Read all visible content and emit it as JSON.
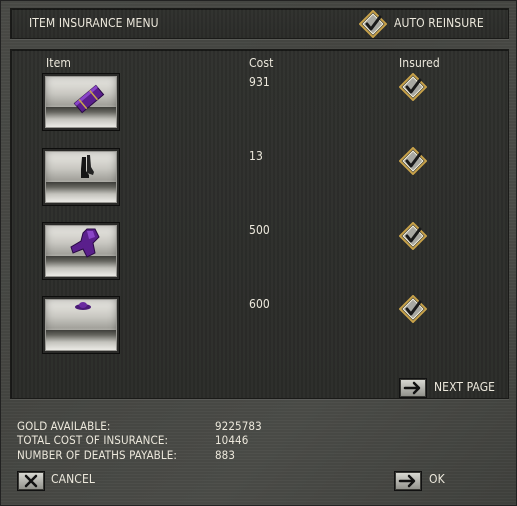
{
  "header": {
    "title": "ITEM INSURANCE MENU",
    "auto_reinsure_label": "AUTO REINSURE",
    "auto_reinsure_checked": true
  },
  "columns": {
    "item": "Item",
    "cost": "Cost",
    "insured": "Insured"
  },
  "items": [
    {
      "cost": "931",
      "insured": true,
      "icon": "purple-book-icon"
    },
    {
      "cost": "13",
      "insured": true,
      "icon": "black-boots-icon"
    },
    {
      "cost": "500",
      "insured": true,
      "icon": "purple-robe-icon"
    },
    {
      "cost": "600",
      "insured": true,
      "icon": "purple-hat-icon"
    }
  ],
  "next_page_label": "NEXT PAGE",
  "summary": {
    "gold_label": "GOLD AVAILABLE:",
    "gold_value": "9225783",
    "total_cost_label": "TOTAL COST OF INSURANCE:",
    "total_cost_value": "10446",
    "deaths_label": "NUMBER OF DEATHS PAYABLE:",
    "deaths_value": "883"
  },
  "cancel_label": "CANCEL",
  "ok_label": "OK",
  "colors": {
    "text": "#ece8dc",
    "panel": "#2d2e2b",
    "frame": "#474844",
    "check_gold": "#c8a24a",
    "item_purple": "#6a2aa0"
  }
}
